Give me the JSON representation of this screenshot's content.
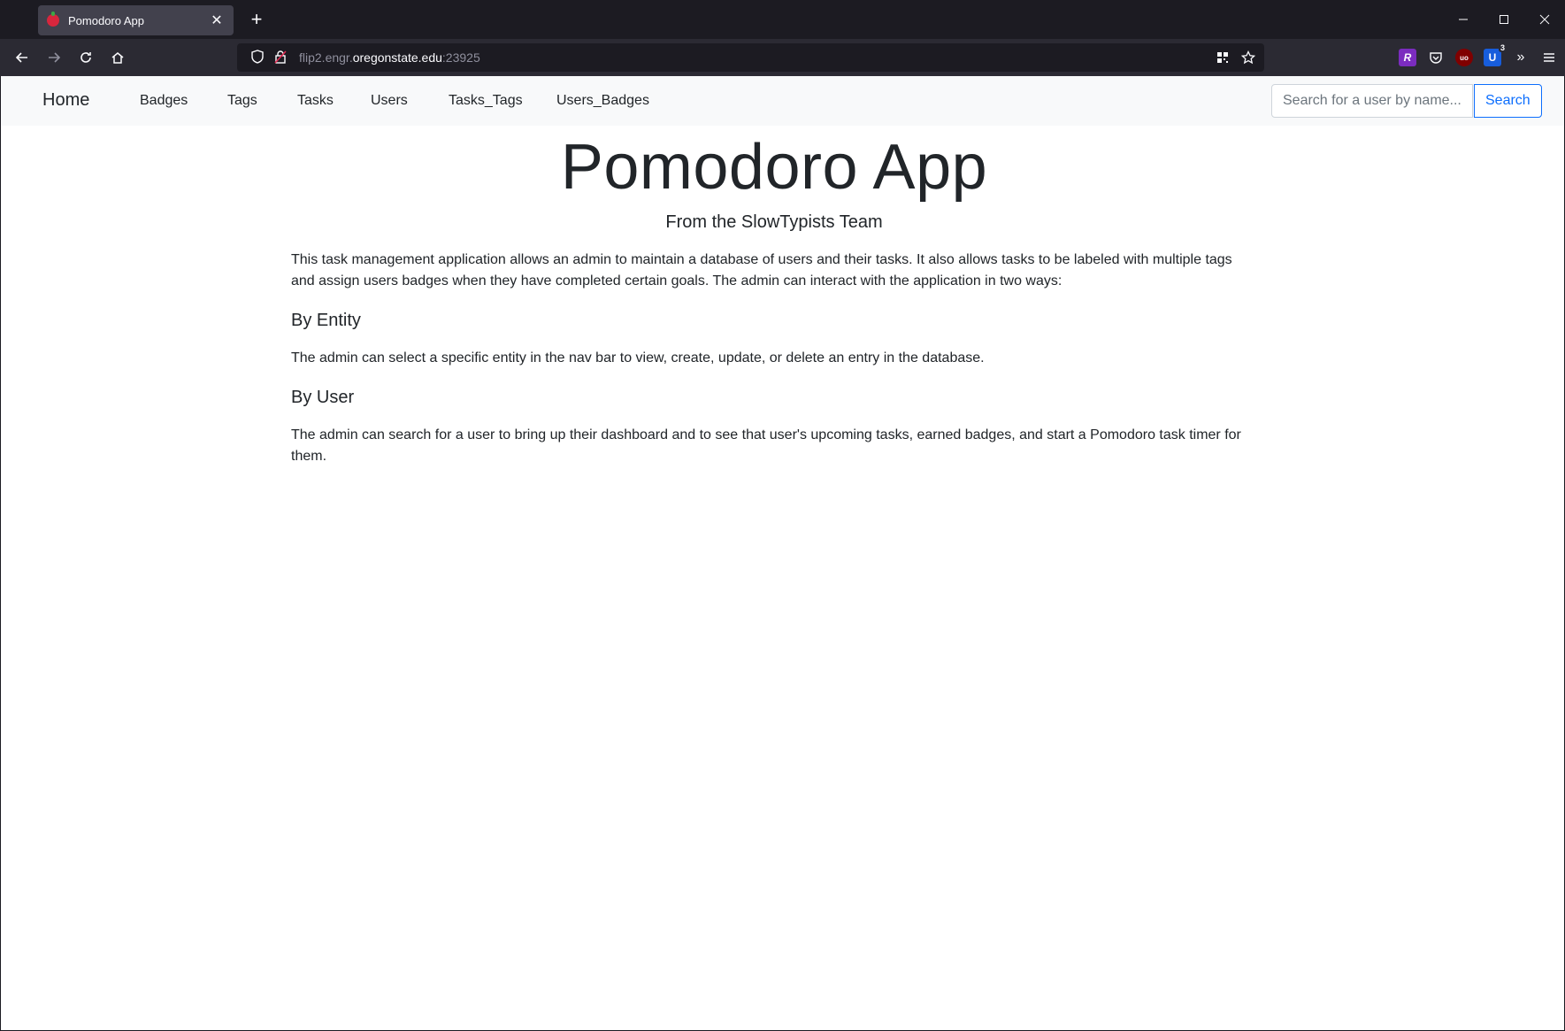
{
  "browser": {
    "tab_title": "Pomodoro App",
    "tab_close": "✕",
    "new_tab": "+",
    "url_gray1": "flip2.engr.",
    "url_host": "oregonstate.edu",
    "url_port": ":23925",
    "extension_badge": "3"
  },
  "site_nav": {
    "brand": "Home",
    "links": [
      "Badges",
      "Tags",
      "Tasks",
      "Users",
      "Tasks_Tags",
      "Users_Badges"
    ],
    "search_placeholder": "Search for a user by name...",
    "search_button": "Search"
  },
  "main": {
    "title": "Pomodoro App",
    "subtitle": "From the SlowTypists Team",
    "intro": "This task management application allows an admin to maintain a database of users and their tasks. It also allows tasks to be labeled with multiple tags and assign users badges when they have completed certain goals. The admin can interact with the application in two ways:",
    "sections": [
      {
        "heading": "By Entity",
        "text": "The admin can select a specific entity in the nav bar to view, create, update, or delete an entry in the database."
      },
      {
        "heading": "By User",
        "text": "The admin can search for a user to bring up their dashboard and to see that user's upcoming tasks, earned badges, and start a Pomodoro task timer for them."
      }
    ]
  }
}
